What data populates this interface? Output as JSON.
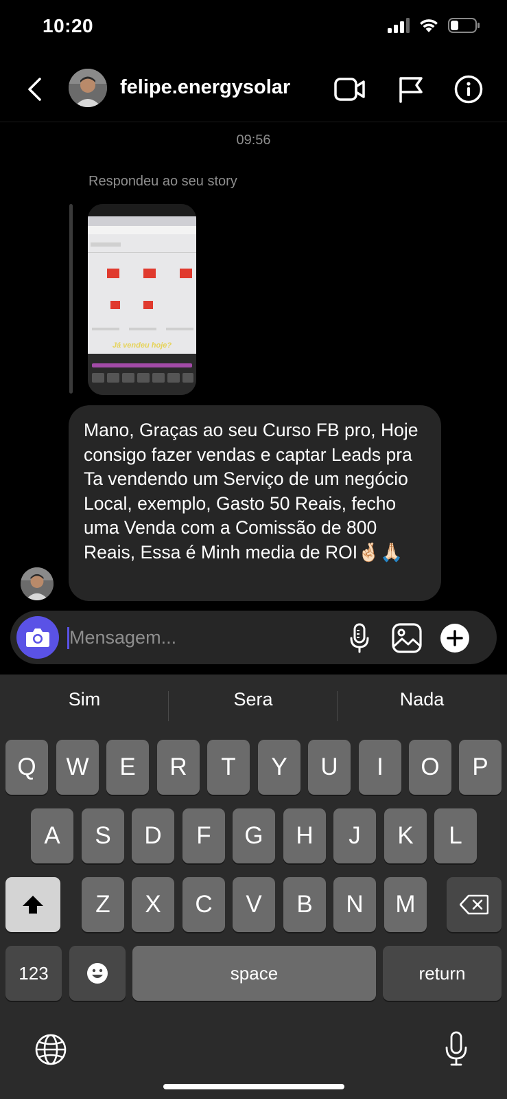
{
  "status_bar": {
    "time": "10:20"
  },
  "header": {
    "username": "felipe.energysolar"
  },
  "messages": {
    "timestamp": "09:56",
    "replied_label": "Respondeu ao seu story",
    "story_caption": "Já vendeu hoje?",
    "bubble_text": "Mano, Graças ao seu Curso FB pro, Hoje consigo fazer vendas e captar Leads pra Ta vendendo um Serviço de um negócio Local, exemplo, Gasto 50 Reais, fecho uma Venda com a Comissão de 800 Reais, Essa é Minh media de ROI🤞🏻🙏🏻"
  },
  "composer": {
    "placeholder": "Mensagem..."
  },
  "keyboard": {
    "suggestions": [
      "Sim",
      "Sera",
      "Nada"
    ],
    "row1": [
      "Q",
      "W",
      "E",
      "R",
      "T",
      "Y",
      "U",
      "I",
      "O",
      "P"
    ],
    "row2": [
      "A",
      "S",
      "D",
      "F",
      "G",
      "H",
      "J",
      "K",
      "L"
    ],
    "row3": [
      "Z",
      "X",
      "C",
      "V",
      "B",
      "N",
      "M"
    ],
    "numbers_label": "123",
    "space_label": "space",
    "return_label": "return"
  },
  "colors": {
    "accent": "#5a52e6",
    "bubble": "#262626",
    "key": "#6b6b6b",
    "key_dark": "#474747"
  }
}
